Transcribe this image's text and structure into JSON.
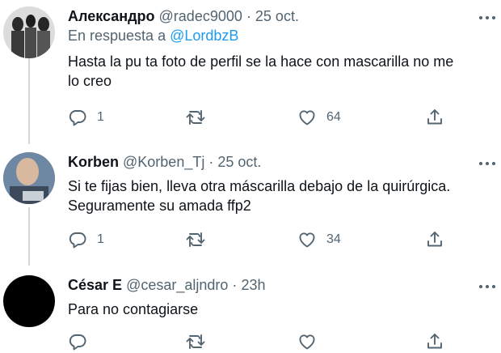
{
  "tweets": [
    {
      "name": "Александро",
      "handle": "@radec9000",
      "separator": "·",
      "time": "25 oct.",
      "reply_prefix": "En respuesta a",
      "reply_to": "@LordbzB",
      "text": "Hasta la pu ta foto de perfil se la hace con mascarilla no me\nlo creo",
      "replies": "1",
      "retweets": "",
      "likes": "64"
    },
    {
      "name": "Korben",
      "handle": "@Korben_Tj",
      "separator": "·",
      "time": "25 oct.",
      "text": "Si te fijas bien, lleva otra máscarilla debajo de la quirúrgica.\nSeguramente su amada ffp2",
      "replies": "1",
      "retweets": "",
      "likes": "34"
    },
    {
      "name": "César E",
      "handle": "@cesar_aljndro",
      "separator": "·",
      "time": "23h",
      "text": "Para no contagiarse",
      "replies": "",
      "retweets": "",
      "likes": ""
    }
  ],
  "icons": {
    "reply": "reply-icon",
    "retweet": "retweet-icon",
    "like": "heart-icon",
    "share": "share-icon",
    "more": "more-icon"
  },
  "colors": {
    "text": "#0f1419",
    "secondary": "#536471",
    "link": "#1d9bf0",
    "thread_line": "#cfd9de"
  }
}
